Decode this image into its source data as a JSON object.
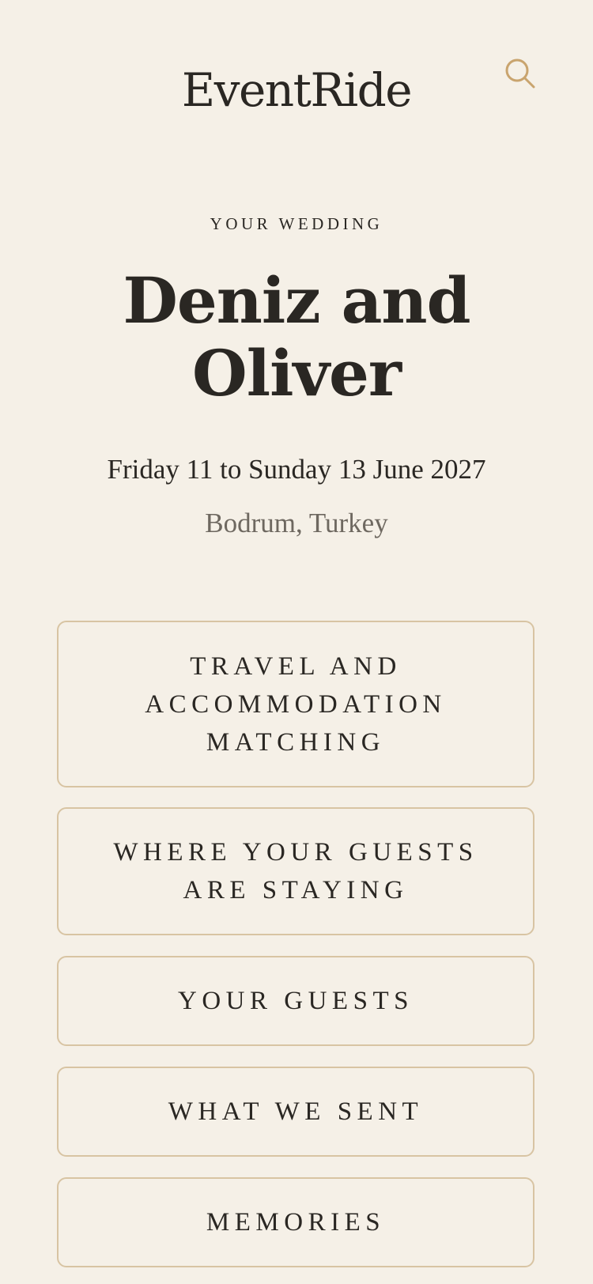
{
  "header": {
    "brand": "EventRide",
    "search_icon": "search-icon"
  },
  "event": {
    "eyebrow": "YOUR WEDDING",
    "couple_line1": "Deniz and",
    "couple_line2": "Oliver",
    "dates": "Friday 11 to Sunday 13 June 2027",
    "location": "Bodrum, Turkey"
  },
  "menu": [
    {
      "label": "TRAVEL AND\nACCOMMODATION\nMATCHING"
    },
    {
      "label": "WHERE YOUR GUESTS\nARE STAYING"
    },
    {
      "label": "YOUR GUESTS"
    },
    {
      "label": "WHAT WE SENT"
    },
    {
      "label": "MEMORIES"
    }
  ],
  "colors": {
    "background": "#f5f0e7",
    "text": "#2a2723",
    "muted": "#6e6860",
    "accent": "#c9a46e",
    "card_border": "#d8c4a3"
  }
}
